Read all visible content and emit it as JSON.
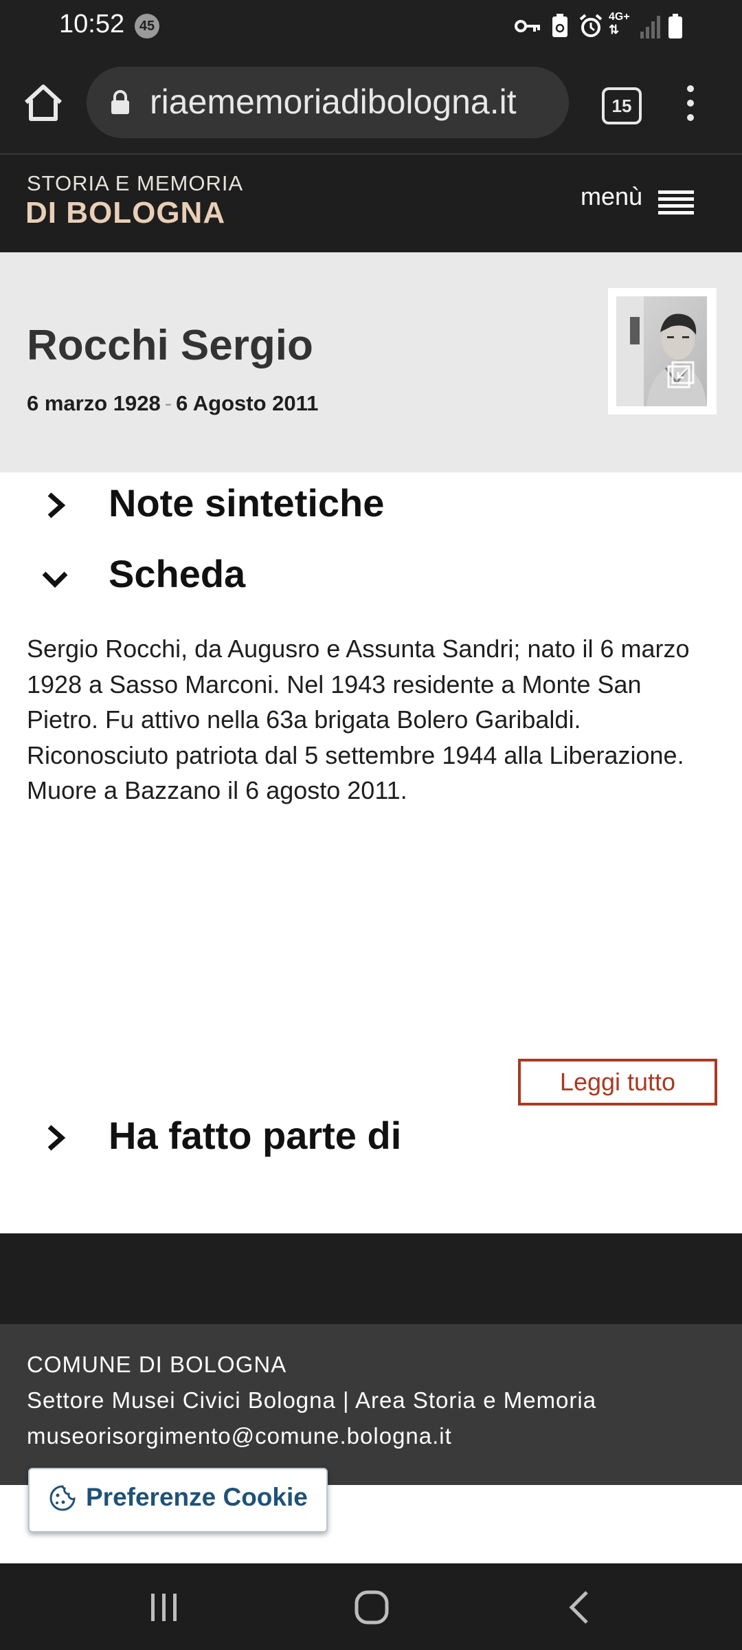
{
  "status_bar": {
    "time": "10:52",
    "notification_count": "45",
    "network_label": "4G+"
  },
  "browser": {
    "url": "riaememoriadibologna.it",
    "tab_count": "15"
  },
  "site_header": {
    "logo_line1": "STORIA E MEMORIA",
    "logo_line2": "DI BOLOGNA",
    "menu_label": "menù"
  },
  "person": {
    "name": "Rocchi Sergio",
    "birth_date": "6 marzo 1928",
    "date_separator": "-",
    "death_date": "6 Agosto 2011"
  },
  "sections": {
    "note": "Note sintetiche",
    "scheda": "Scheda",
    "ha_fatto_parte": "Ha fatto parte di"
  },
  "bio": "Sergio Rocchi, da Augusro e Assunta Sandri; nato il 6 marzo 1928 a Sasso Marconi. Nel 1943 residente a Monte San Pietro. Fu attivo nella 63a brigata Bolero Garibaldi. Riconosciuto patriota dal 5 settembre 1944 alla Liberazione. Muore a Bazzano il 6 agosto 2011.",
  "read_more": "Leggi tutto",
  "footer": {
    "line1": "COMUNE DI BOLOGNA",
    "line2": "Settore Musei Civici Bologna | Area Storia e Memoria",
    "line3": "museorisorgimento@comune.bologna.it"
  },
  "cookie_button": "Preferenze Cookie",
  "colors": {
    "accent_red": "#a83a22",
    "logo_beige": "#e8cfb7",
    "cookie_blue": "#1f5277"
  }
}
